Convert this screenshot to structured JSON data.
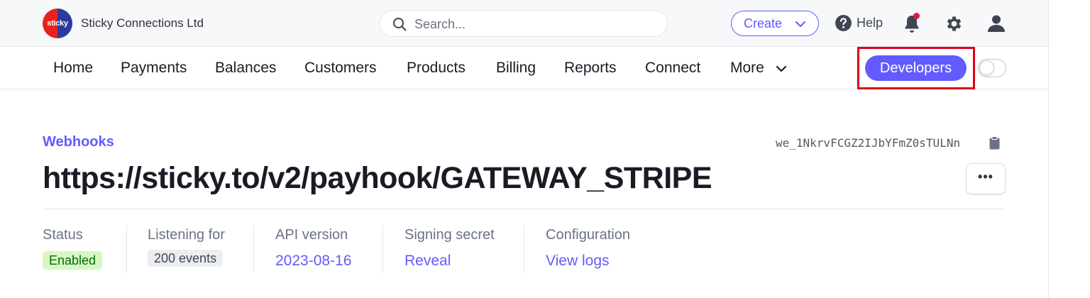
{
  "topbar": {
    "logo_text": "sticky",
    "logo_colors": [
      "#e5231b",
      "#2b3a9e"
    ],
    "company_name": "Sticky Connections Ltd",
    "search": {
      "placeholder": "Search...",
      "value": ""
    },
    "create_label": "Create",
    "help_label": "Help",
    "notification_dot_color": "#df1b41",
    "icons": [
      "search-icon",
      "chevron-down-icon",
      "help-icon",
      "bell-icon",
      "gear-icon",
      "user-icon"
    ]
  },
  "nav": {
    "items": [
      "Home",
      "Payments",
      "Balances",
      "Customers",
      "Products",
      "Billing",
      "Reports",
      "Connect",
      "More"
    ],
    "developers_label": "Developers",
    "test_mode_toggle": false,
    "accent": "#635bff",
    "highlight_color": "#e0001b"
  },
  "webhook": {
    "breadcrumb": "Webhooks",
    "id": "we_1NkrvFCGZ2IJbYFmZ0sTULNn",
    "url": "https://sticky.to/v2/payhook/GATEWAY_STRIPE",
    "more_label": "•••"
  },
  "details": {
    "status": {
      "label": "Status",
      "value": "Enabled"
    },
    "listening": {
      "label": "Listening for",
      "value": "200 events"
    },
    "api_version": {
      "label": "API version",
      "value": "2023-08-16"
    },
    "signing_secret": {
      "label": "Signing secret",
      "value": "Reveal"
    },
    "configuration": {
      "label": "Configuration",
      "value": "View logs"
    }
  }
}
